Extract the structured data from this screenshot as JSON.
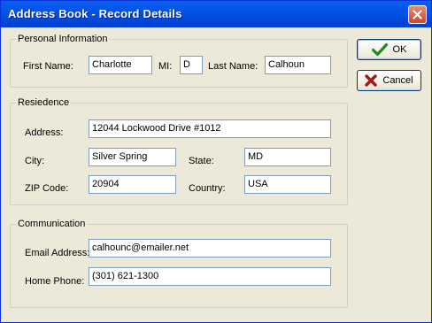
{
  "window": {
    "title": "Address Book - Record Details"
  },
  "buttons": {
    "ok": "OK",
    "cancel": "Cancel"
  },
  "personal": {
    "title": "Personal Information",
    "first_name_label": "First Name:",
    "first_name": "Charlotte",
    "mi_label": "MI:",
    "mi": "D",
    "last_name_label": "Last Name:",
    "last_name": "Calhoun"
  },
  "residence": {
    "title": "Resiedence",
    "address_label": "Address:",
    "address": "12044 Lockwood Drive #1012",
    "city_label": "City:",
    "city": "Silver Spring",
    "state_label": "State:",
    "state": "MD",
    "zip_label": "ZIP Code:",
    "zip": "20904",
    "country_label": "Country:",
    "country": "USA"
  },
  "communication": {
    "title": "Communication",
    "email_label": "Email Address:",
    "email": "calhounc@emailer.net",
    "phone_label": "Home Phone:",
    "phone": "(301) 621-1300"
  }
}
